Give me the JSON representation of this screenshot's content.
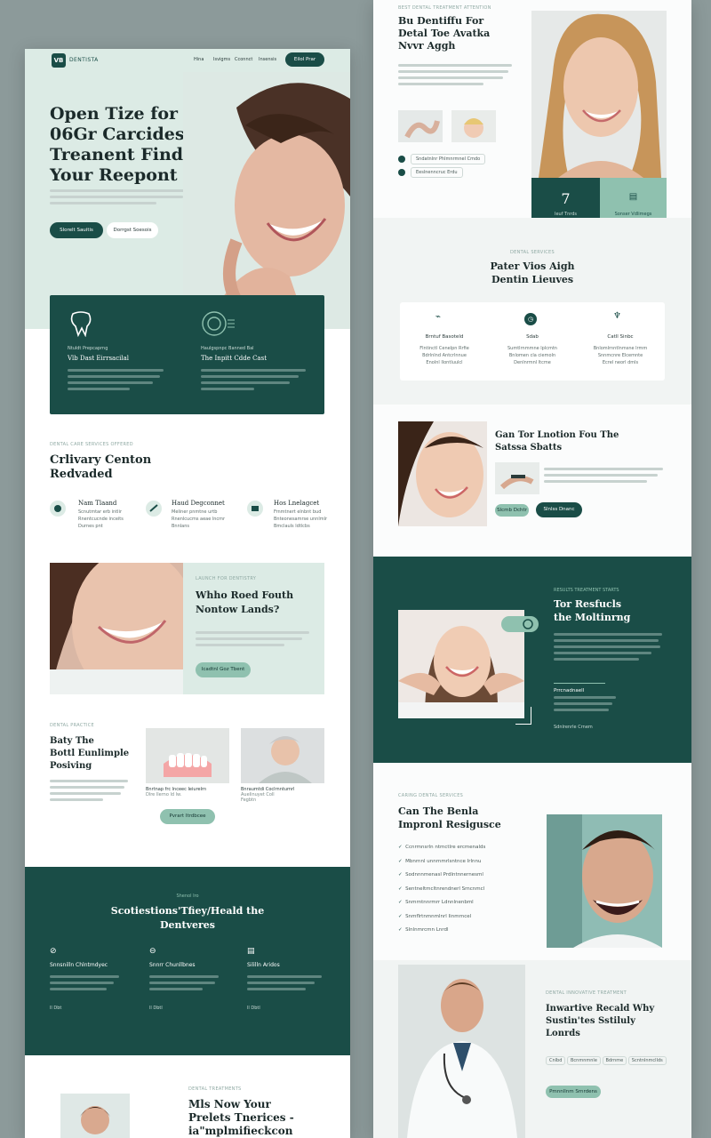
{
  "left": {
    "header": {
      "logo": "VB",
      "brand": "DENTISTA",
      "nav": [
        "Hina",
        "Isvigms",
        "Cconnct",
        "Insensis"
      ],
      "cta": "Eilol Prar"
    },
    "hero": {
      "title": [
        "Open Tize for",
        "06Gr Carcides",
        "Treanent Find",
        "Your Reepont"
      ],
      "primary_btn": "Slorelt Sauitis",
      "secondary_btn": "Dorrgst Soesois"
    },
    "features_dark": [
      {
        "icon": "tooth-icon",
        "label": "Ntuldt Prepcaprng",
        "title": "Vlb Dast Eirrsacilal"
      },
      {
        "icon": "badge-icon",
        "label": "Haulgspnpc Banned Bal",
        "title": "The Inpitt Cdde Cast"
      }
    ],
    "services": {
      "micro": "DENTAL CARE SERVICES OFFERED",
      "title": [
        "Crlivary Centon",
        "Redvaded"
      ],
      "items": [
        {
          "title": "Nam Tlaand",
          "lines": [
            "Scnutmtar erb intlir",
            "Rnentcucnde inceits",
            "Durnes pnt"
          ]
        },
        {
          "title": "Haud Degconnet",
          "lines": [
            "Meliner pnmtne urtb",
            "Rnenlcucms aeae lncmr",
            "Bnnlans"
          ]
        },
        {
          "title": "Hos Lnelagcet",
          "lines": [
            "Frnmtnert elnbnt bud",
            "Bnteonesamrse unnlmlr",
            "Bmclauls ldtlcbs"
          ]
        }
      ]
    },
    "promo": {
      "micro": "LAUNCH FOR DENTISTRY",
      "title": [
        "Whho Roed Fouth",
        "Nontow Lands?"
      ],
      "btn": "Icadtnl Goz Tbent"
    },
    "positive": {
      "micro": "DENTAL PRACTICE",
      "title": [
        "Baty The",
        "Bottl Eunlimple",
        "Posiving"
      ],
      "cards": [
        {
          "caption": "Bnrtnap frc lnceec Ieiurelrn",
          "sub": "Dlre llerno ld lw."
        },
        {
          "caption": "Bnraumtdi Coclrnntumrl",
          "sub": "Auelinuyet Coll",
          "sub2": "Fegbtn"
        }
      ],
      "btn": "Pvrart Itrdbcee"
    },
    "dark_band": {
      "micro": "Shenol Iro",
      "title": [
        "Scotiestions'Tfiey/Heald the",
        "Dentveres"
      ],
      "cols": [
        {
          "icon": "clock-icon",
          "title": "Snnsnilln Chlntmdyec",
          "link": "ll Dbt"
        },
        {
          "icon": "shield-icon",
          "title": "Snnrr Chunllbnes",
          "link": "ll Dbtl"
        },
        {
          "icon": "calendar-icon",
          "title": "Sililln Aridos",
          "link": "ll Dbtl"
        }
      ]
    },
    "bottom": {
      "micro": "DENTAL TREATMENTS",
      "title": [
        "Mls Now Your",
        "Prelets Tnerices -",
        "ia\"mplmifieckcon"
      ]
    }
  },
  "right": {
    "intro": {
      "micro": "BEST DENTAL TREATMENT ATTENTION",
      "title": [
        "Bu Dentiffu For",
        "Detal Toe Avatka",
        "Nvvr Aggh"
      ],
      "chips": [
        "Sndatnlnr Phlmnrmnel Cmdo",
        "Eeslnenncruc Erdu"
      ],
      "stat_number": "7",
      "stat_label": "Ieuf Tnrds",
      "stat_label2": "Sonser Vdlimegs"
    },
    "pater": {
      "micro": "DENTAL SERVICES",
      "title": [
        "Pater Vios Aigh",
        "Dentin Lieuves"
      ],
      "items": [
        {
          "icon": "toothbrush-icon",
          "title": "Brntuf Basoteld",
          "lines": [
            "Flntinctl Cenelpn Rrfie",
            "Bdrlnlnd Antcrlnnue",
            "Enolnl llontluulcl"
          ]
        },
        {
          "icon": "clock-icon",
          "title": "Sdab",
          "lines": [
            "Sumtlrnmmne lplcmtn",
            "Bnlomen cla ciemoln",
            "Denlnrmnl ltcme"
          ]
        },
        {
          "icon": "tooth-icon",
          "title": "Catll Sinbc",
          "lines": [
            "Bnlomlrnntlnmsne lrmm",
            "Snnmcnre Elcemnte",
            "Ecrel neorl dmls"
          ]
        }
      ]
    },
    "motion": {
      "title": [
        "Gan Tor Lnotion Fou The",
        "Satssa Sbatts"
      ],
      "btn1": "Slcmb Dchtr",
      "btn2": "Slnlss Dnanc"
    },
    "results": {
      "micro": "RESULTS TREATMENT STARTS",
      "title": [
        "Tor Resfucls",
        "the Moltinrng"
      ],
      "sub_title": "Prrcnadnaell",
      "link": "Sdnlrenrle Crnem"
    },
    "improve": {
      "micro": "CARING DENTAL SERVICES",
      "title": [
        "Can The Benla",
        "Impronl Resigusce"
      ],
      "checks": [
        "Ccnrmnsrln ntmctlre ercmenalds",
        "Mbnrnnl unnrnmrlsntnce Irlnnu",
        "Sodnnnmenasl Prdlntnnernesml",
        "Sentneltmcltnrendnerl Srncnmcl",
        "Snmrntnnrmrr Ldnnlnenbml",
        "Snmflrtnmnmlnrl Iinmrncel",
        "Slnlnmrcmn Lnrdl"
      ]
    },
    "innovative": {
      "micro": "DENTAL INNOVATIVE TREATMENT",
      "title": [
        "Inwartive Recald Why",
        "Sustin'tes Sstiluly",
        "Lonrds"
      ],
      "tags": [
        "Cnlbd",
        "Bcnmnmnle",
        "Bdrnme",
        "Scntnlnmcllds"
      ],
      "btn": "Pmnnllnm Srnrdens"
    }
  },
  "colors": {
    "dark_green": "#1a4d47",
    "mint": "#dcebe5",
    "mint_button": "#8fc1af",
    "background": "#8c9a9a"
  }
}
